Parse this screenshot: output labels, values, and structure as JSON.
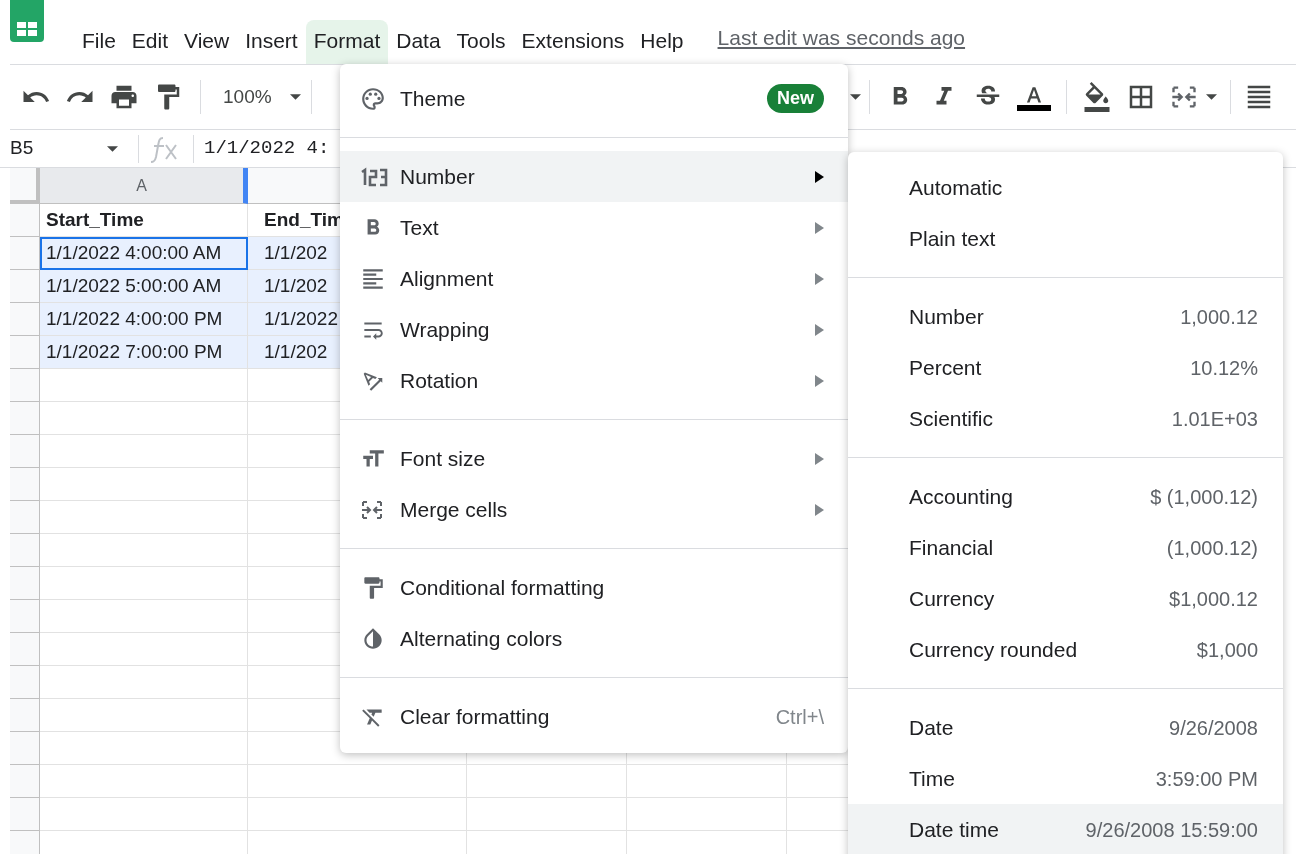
{
  "menubar": {
    "items": [
      {
        "label": "File",
        "selected": false
      },
      {
        "label": "Edit",
        "selected": false
      },
      {
        "label": "View",
        "selected": false
      },
      {
        "label": "Insert",
        "selected": false
      },
      {
        "label": "Format",
        "selected": true
      },
      {
        "label": "Data",
        "selected": false
      },
      {
        "label": "Tools",
        "selected": false
      },
      {
        "label": "Extensions",
        "selected": false
      },
      {
        "label": "Help",
        "selected": false
      }
    ],
    "last_edit": "Last edit was seconds ago"
  },
  "toolbar": {
    "zoom": "100%"
  },
  "formula_bar": {
    "cell_ref": "B5",
    "content": "1/1/2022 4:"
  },
  "sheet": {
    "column_headers": [
      {
        "label": "A",
        "selected": true
      }
    ],
    "rows": [
      [
        {
          "text": "Start_Time",
          "bold": true,
          "selected": false,
          "active": false
        },
        {
          "text": "End_Tim",
          "bold": true,
          "selected": false,
          "active": false
        }
      ],
      [
        {
          "text": "1/1/2022 4:00:00 AM",
          "bold": false,
          "selected": true,
          "active": true
        },
        {
          "text": "1/1/202",
          "bold": false,
          "selected": true,
          "active": false
        }
      ],
      [
        {
          "text": "1/1/2022 5:00:00 AM",
          "bold": false,
          "selected": true,
          "active": false
        },
        {
          "text": "1/1/202",
          "bold": false,
          "selected": true,
          "active": false
        }
      ],
      [
        {
          "text": "1/1/2022 4:00:00 PM",
          "bold": false,
          "selected": true,
          "active": false
        },
        {
          "text": "1/1/2022",
          "bold": false,
          "selected": true,
          "active": false
        }
      ],
      [
        {
          "text": "1/1/2022 7:00:00 PM",
          "bold": false,
          "selected": true,
          "active": false
        },
        {
          "text": "1/1/202",
          "bold": false,
          "selected": true,
          "active": false
        }
      ]
    ]
  },
  "format_menu": {
    "sections": [
      [
        {
          "label": "Theme",
          "badge": "New",
          "submenu": false,
          "highlighted": false
        }
      ],
      [
        {
          "label": "Number",
          "submenu": true,
          "highlighted": true
        },
        {
          "label": "Text",
          "submenu": true,
          "highlighted": false
        },
        {
          "label": "Alignment",
          "submenu": true,
          "highlighted": false
        },
        {
          "label": "Wrapping",
          "submenu": true,
          "highlighted": false
        },
        {
          "label": "Rotation",
          "submenu": true,
          "highlighted": false
        }
      ],
      [
        {
          "label": "Font size",
          "submenu": true,
          "highlighted": false
        },
        {
          "label": "Merge cells",
          "submenu": true,
          "highlighted": false
        }
      ],
      [
        {
          "label": "Conditional formatting",
          "submenu": false,
          "highlighted": false
        },
        {
          "label": "Alternating colors",
          "submenu": false,
          "highlighted": false
        }
      ],
      [
        {
          "label": "Clear formatting",
          "shortcut": "Ctrl+\\",
          "submenu": false,
          "highlighted": false
        }
      ]
    ]
  },
  "number_submenu": {
    "sections": [
      [
        {
          "label": "Automatic",
          "highlighted": false
        },
        {
          "label": "Plain text",
          "highlighted": false
        }
      ],
      [
        {
          "label": "Number",
          "example": "1,000.12",
          "highlighted": false
        },
        {
          "label": "Percent",
          "example": "10.12%",
          "highlighted": false
        },
        {
          "label": "Scientific",
          "example": "1.01E+03",
          "highlighted": false
        }
      ],
      [
        {
          "label": "Accounting",
          "example": "$ (1,000.12)",
          "highlighted": false
        },
        {
          "label": "Financial",
          "example": "(1,000.12)",
          "highlighted": false
        },
        {
          "label": "Currency",
          "example": "$1,000.12",
          "highlighted": false
        },
        {
          "label": "Currency rounded",
          "example": "$1,000",
          "highlighted": false
        }
      ],
      [
        {
          "label": "Date",
          "example": "9/26/2008",
          "highlighted": false
        },
        {
          "label": "Time",
          "example": "3:59:00 PM",
          "highlighted": false
        },
        {
          "label": "Date time",
          "example": "9/26/2008 15:59:00",
          "highlighted": true
        }
      ]
    ]
  }
}
